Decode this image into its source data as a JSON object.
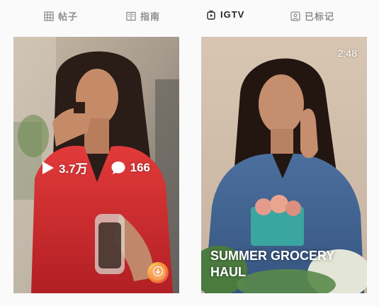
{
  "tabs": [
    {
      "label": "帖子",
      "icon": "grid-icon",
      "active": false
    },
    {
      "label": "指南",
      "icon": "guide-icon",
      "active": false
    },
    {
      "label": "IGTV",
      "icon": "igtv-icon",
      "active": true
    },
    {
      "label": "已标记",
      "icon": "tagged-icon",
      "active": false
    }
  ],
  "videos": [
    {
      "views": "3.7万",
      "comments": "166",
      "view_icon": "play-icon",
      "comment_icon": "comment-icon",
      "badge_icon": "download-icon"
    },
    {
      "duration": "2:48",
      "title": "SUMMER GROCERY HAUL"
    }
  ],
  "colors": {
    "active_tab": "#262626",
    "inactive_tab": "#8e8e8e",
    "background": "#fafafa"
  }
}
